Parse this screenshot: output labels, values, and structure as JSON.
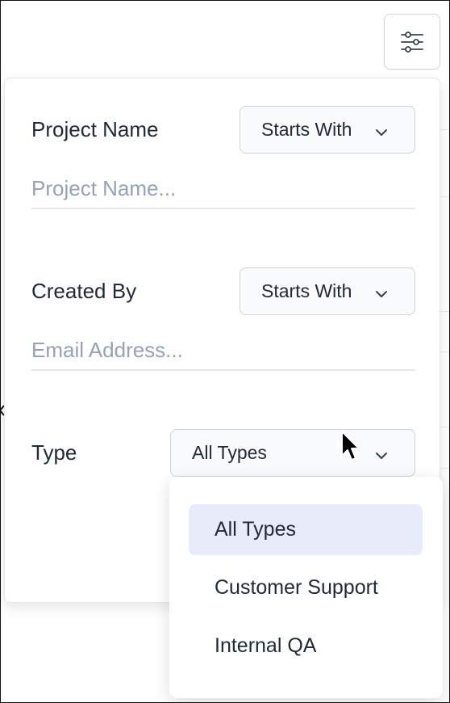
{
  "filter_panel": {
    "project_name": {
      "label": "Project Name",
      "operator": "Starts With",
      "placeholder": "Project Name...",
      "value": ""
    },
    "created_by": {
      "label": "Created By",
      "operator": "Starts With",
      "placeholder": "Email Address...",
      "value": ""
    },
    "type": {
      "label": "Type",
      "selected": "All Types",
      "options": [
        "All Types",
        "Customer Support",
        "Internal QA"
      ]
    }
  },
  "icons": {
    "filter_toggle": "sliders-icon",
    "chevron": "chevron-down-icon",
    "cursor": "mouse-pointer-icon"
  },
  "colors": {
    "selected_option_bg": "#e8ebf9",
    "placeholder_text": "#94a3b8",
    "select_bg": "#f8fafc",
    "border": "#d1d5db"
  }
}
